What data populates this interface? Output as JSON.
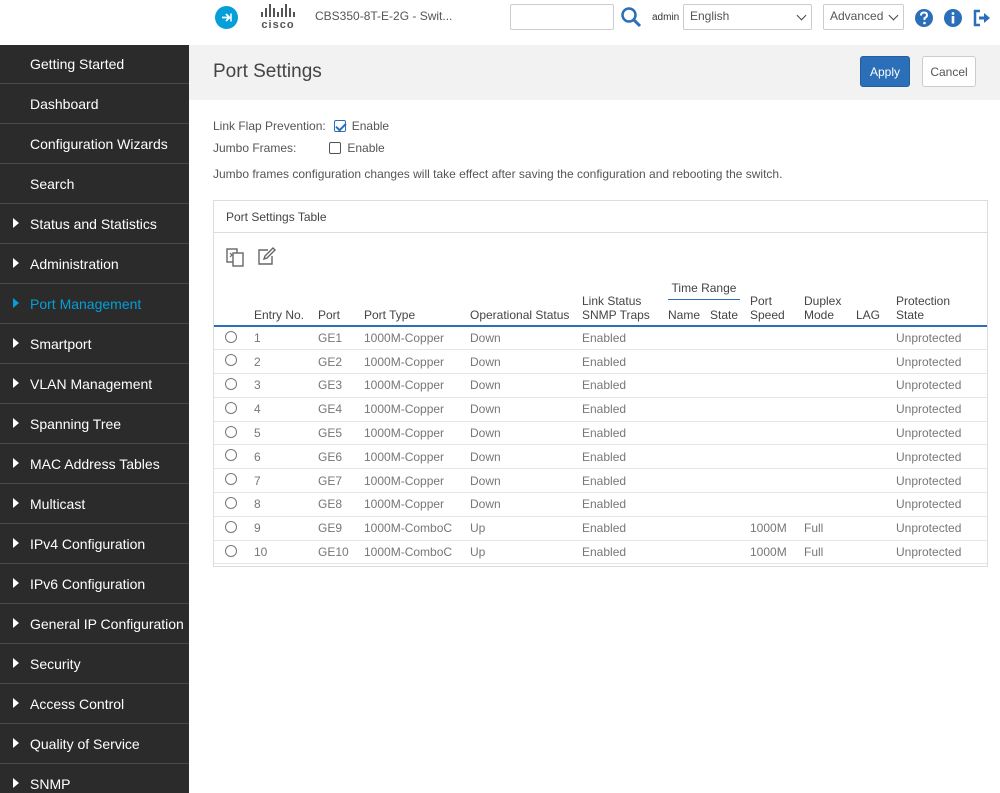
{
  "header": {
    "device_name": "CBS350-8T-E-2G - Swit...",
    "cisco_logo_text": "cisco",
    "search_value": "",
    "user": "admin",
    "language": "English",
    "mode": "Advanced"
  },
  "sidebar": {
    "items": [
      {
        "label": "Getting Started",
        "arrow": false,
        "active": false
      },
      {
        "label": "Dashboard",
        "arrow": false,
        "active": false
      },
      {
        "label": "Configuration Wizards",
        "arrow": false,
        "active": false
      },
      {
        "label": "Search",
        "arrow": false,
        "active": false
      },
      {
        "label": "Status and Statistics",
        "arrow": true,
        "active": false
      },
      {
        "label": "Administration",
        "arrow": true,
        "active": false
      },
      {
        "label": "Port Management",
        "arrow": true,
        "active": true
      },
      {
        "label": "Smartport",
        "arrow": true,
        "active": false
      },
      {
        "label": "VLAN Management",
        "arrow": true,
        "active": false
      },
      {
        "label": "Spanning Tree",
        "arrow": true,
        "active": false
      },
      {
        "label": "MAC Address Tables",
        "arrow": true,
        "active": false
      },
      {
        "label": "Multicast",
        "arrow": true,
        "active": false
      },
      {
        "label": "IPv4 Configuration",
        "arrow": true,
        "active": false
      },
      {
        "label": "IPv6 Configuration",
        "arrow": true,
        "active": false
      },
      {
        "label": "General IP Configuration",
        "arrow": true,
        "active": false
      },
      {
        "label": "Security",
        "arrow": true,
        "active": false
      },
      {
        "label": "Access Control",
        "arrow": true,
        "active": false
      },
      {
        "label": "Quality of Service",
        "arrow": true,
        "active": false
      },
      {
        "label": "SNMP",
        "arrow": true,
        "active": false
      }
    ]
  },
  "page": {
    "title": "Port Settings",
    "apply_label": "Apply",
    "cancel_label": "Cancel",
    "link_flap_label": "Link Flap Prevention:",
    "link_flap_enable_label": "Enable",
    "link_flap_checked": true,
    "jumbo_label": "Jumbo Frames:",
    "jumbo_enable_label": "Enable",
    "jumbo_checked": false,
    "note": "Jumbo frames configuration changes will take effect after saving the configuration and rebooting the switch."
  },
  "table": {
    "title": "Port Settings Table",
    "headers": {
      "entry": "Entry No.",
      "port": "Port",
      "port_type": "Port Type",
      "oper_status": "Operational Status",
      "link_status_line1": "Link Status",
      "link_status_line2": "SNMP Traps",
      "time_range": "Time Range",
      "tr_name": "Name",
      "tr_state": "State",
      "speed_line1": "Port",
      "speed_line2": "Speed",
      "duplex_line1": "Duplex",
      "duplex_line2": "Mode",
      "lag": "LAG",
      "protection_line1": "Protection",
      "protection_line2": "State"
    },
    "rows": [
      {
        "entry": "1",
        "port": "GE1",
        "type": "1000M-Copper",
        "oper": "Down",
        "traps": "Enabled",
        "name": "",
        "state": "",
        "speed": "",
        "duplex": "",
        "lag": "",
        "protection": "Unprotected"
      },
      {
        "entry": "2",
        "port": "GE2",
        "type": "1000M-Copper",
        "oper": "Down",
        "traps": "Enabled",
        "name": "",
        "state": "",
        "speed": "",
        "duplex": "",
        "lag": "",
        "protection": "Unprotected"
      },
      {
        "entry": "3",
        "port": "GE3",
        "type": "1000M-Copper",
        "oper": "Down",
        "traps": "Enabled",
        "name": "",
        "state": "",
        "speed": "",
        "duplex": "",
        "lag": "",
        "protection": "Unprotected"
      },
      {
        "entry": "4",
        "port": "GE4",
        "type": "1000M-Copper",
        "oper": "Down",
        "traps": "Enabled",
        "name": "",
        "state": "",
        "speed": "",
        "duplex": "",
        "lag": "",
        "protection": "Unprotected"
      },
      {
        "entry": "5",
        "port": "GE5",
        "type": "1000M-Copper",
        "oper": "Down",
        "traps": "Enabled",
        "name": "",
        "state": "",
        "speed": "",
        "duplex": "",
        "lag": "",
        "protection": "Unprotected"
      },
      {
        "entry": "6",
        "port": "GE6",
        "type": "1000M-Copper",
        "oper": "Down",
        "traps": "Enabled",
        "name": "",
        "state": "",
        "speed": "",
        "duplex": "",
        "lag": "",
        "protection": "Unprotected"
      },
      {
        "entry": "7",
        "port": "GE7",
        "type": "1000M-Copper",
        "oper": "Down",
        "traps": "Enabled",
        "name": "",
        "state": "",
        "speed": "",
        "duplex": "",
        "lag": "",
        "protection": "Unprotected"
      },
      {
        "entry": "8",
        "port": "GE8",
        "type": "1000M-Copper",
        "oper": "Down",
        "traps": "Enabled",
        "name": "",
        "state": "",
        "speed": "",
        "duplex": "",
        "lag": "",
        "protection": "Unprotected"
      },
      {
        "entry": "9",
        "port": "GE9",
        "type": "1000M-ComboC",
        "oper": "Up",
        "traps": "Enabled",
        "name": "",
        "state": "",
        "speed": "1000M",
        "duplex": "Full",
        "lag": "",
        "protection": "Unprotected"
      },
      {
        "entry": "10",
        "port": "GE10",
        "type": "1000M-ComboC",
        "oper": "Up",
        "traps": "Enabled",
        "name": "",
        "state": "",
        "speed": "1000M",
        "duplex": "Full",
        "lag": "",
        "protection": "Unprotected"
      }
    ]
  },
  "colors": {
    "accent": "#049fd9",
    "primary_button": "#2a6fb8",
    "sidebar_bg": "#2b2b2b",
    "header_bg": "#f2f2f2"
  },
  "icons": {
    "nav_toggle": "arrow-right-circle-icon",
    "search": "search-icon",
    "help": "help-icon",
    "info": "info-icon",
    "logout": "logout-icon",
    "copy": "copy-settings-icon",
    "edit": "edit-icon"
  }
}
